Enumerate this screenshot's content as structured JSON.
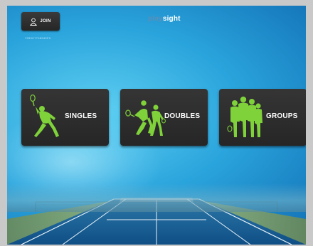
{
  "header": {
    "join_label": "JOIN",
    "code_text": "7250C7748949F0",
    "logo_play": "play",
    "logo_sight": "sight"
  },
  "modes": [
    {
      "label": "SINGLES",
      "icon": "tennis-player-icon"
    },
    {
      "label": "DOUBLES",
      "icon": "two-players-icon"
    },
    {
      "label": "GROUPS",
      "icon": "group-of-players-icon"
    }
  ],
  "colors": {
    "accent_green": "#7fd23a",
    "button_dark": "#2e2e2e",
    "logo_play": "#5a8fb8"
  }
}
